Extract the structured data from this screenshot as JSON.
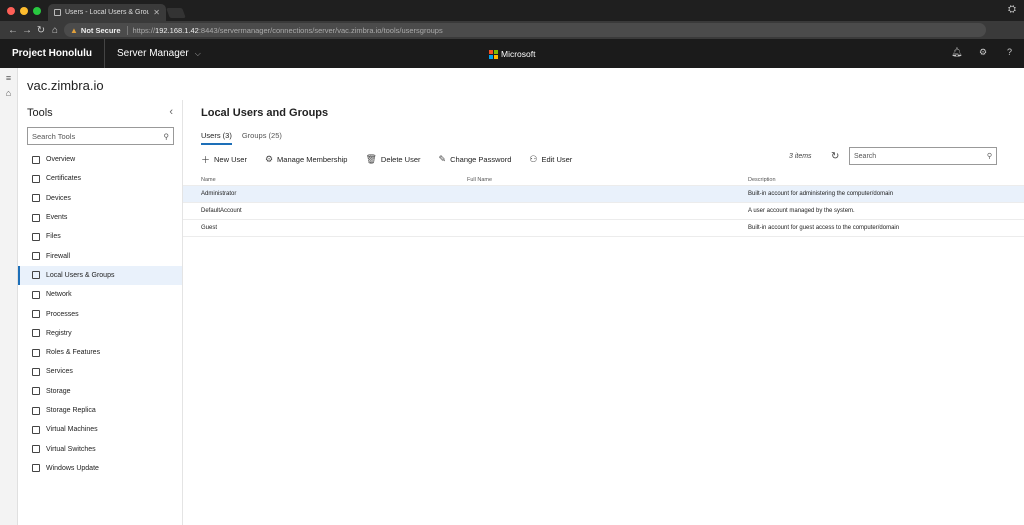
{
  "browser": {
    "tab_title": "Users - Local Users & Groups",
    "not_secure": "Not Secure",
    "url_scheme": "https://",
    "url_host": "192.168.1.42",
    "url_rest": ":8443/servermanager/connections/server/vac.zimbra.io/tools/usersgroups"
  },
  "header": {
    "brand": "Project Honolulu",
    "app": "Server Manager",
    "vendor": "Microsoft"
  },
  "server": {
    "name": "vac.zimbra.io"
  },
  "tools": {
    "title": "Tools",
    "search_placeholder": "Search Tools",
    "items": [
      {
        "label": "Overview",
        "icon": "overview-icon"
      },
      {
        "label": "Certificates",
        "icon": "certificate-icon"
      },
      {
        "label": "Devices",
        "icon": "devices-icon"
      },
      {
        "label": "Events",
        "icon": "events-icon"
      },
      {
        "label": "Files",
        "icon": "files-icon"
      },
      {
        "label": "Firewall",
        "icon": "firewall-icon"
      },
      {
        "label": "Local Users & Groups",
        "icon": "users-icon"
      },
      {
        "label": "Network",
        "icon": "network-icon"
      },
      {
        "label": "Processes",
        "icon": "processes-icon"
      },
      {
        "label": "Registry",
        "icon": "registry-icon"
      },
      {
        "label": "Roles & Features",
        "icon": "roles-icon"
      },
      {
        "label": "Services",
        "icon": "services-icon"
      },
      {
        "label": "Storage",
        "icon": "storage-icon"
      },
      {
        "label": "Storage Replica",
        "icon": "storage-replica-icon"
      },
      {
        "label": "Virtual Machines",
        "icon": "vm-icon"
      },
      {
        "label": "Virtual Switches",
        "icon": "switch-icon"
      },
      {
        "label": "Windows Update",
        "icon": "update-icon"
      }
    ],
    "active_index": 6
  },
  "main": {
    "title": "Local Users and Groups",
    "tabs": [
      {
        "label": "Users (3)"
      },
      {
        "label": "Groups (25)"
      }
    ],
    "commands": [
      {
        "label": "New User",
        "icon": "plus-icon"
      },
      {
        "label": "Manage Membership",
        "icon": "gear-icon"
      },
      {
        "label": "Delete User",
        "icon": "trash-icon"
      },
      {
        "label": "Change Password",
        "icon": "pencil-icon"
      },
      {
        "label": "Edit User",
        "icon": "person-icon"
      }
    ],
    "count": "3 items",
    "search_placeholder": "Search",
    "columns": [
      "Name",
      "Full Name",
      "Description"
    ],
    "rows": [
      {
        "name": "Administrator",
        "full_name": "",
        "description": "Built-in account for administering the computer/domain"
      },
      {
        "name": "DefaultAccount",
        "full_name": "",
        "description": "A user account managed by the system."
      },
      {
        "name": "Guest",
        "full_name": "",
        "description": "Built-in account for guest access to the computer/domain"
      }
    ]
  }
}
